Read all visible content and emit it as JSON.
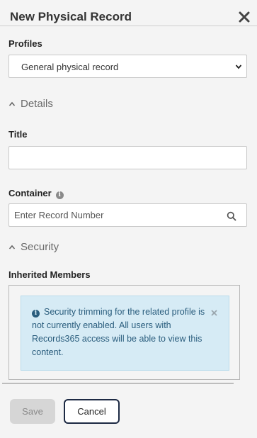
{
  "header": {
    "title": "New Physical Record",
    "close_icon": "close-icon"
  },
  "profiles": {
    "label": "Profiles",
    "selected": "General physical record"
  },
  "details_section": {
    "label": "Details"
  },
  "title_field": {
    "label": "Title",
    "value": ""
  },
  "container_field": {
    "label": "Container",
    "placeholder": "Enter Record Number"
  },
  "security_section": {
    "label": "Security"
  },
  "inherited_members": {
    "label": "Inherited Members",
    "alert_text": "Security trimming for the related profile is not currently enabled. All users with Records365 access will be able to view this content."
  },
  "footer": {
    "save_label": "Save",
    "cancel_label": "Cancel"
  },
  "colors": {
    "alert_bg": "#d6ebf5",
    "alert_text": "#2a5d7d",
    "cancel_border": "#1d2a44"
  }
}
